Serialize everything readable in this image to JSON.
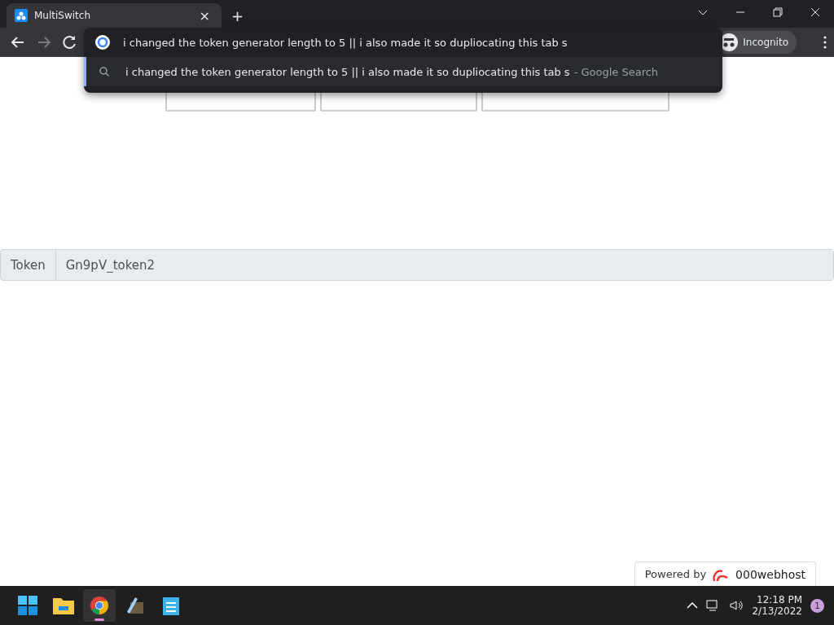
{
  "browser": {
    "tab": {
      "title": "MultiSwitch",
      "close": "×"
    },
    "new_tab": "+",
    "omnibox": {
      "value": "i changed the token generator length to 5 || i also made it so dupliocating this tab s"
    },
    "suggestion": {
      "text": "i changed the token generator length to 5 || i also made it so dupliocating this tab s",
      "source": "- Google Search"
    },
    "profile": "Incognito"
  },
  "page": {
    "buttons": [
      {
        "kind": "button"
      },
      {
        "kind": "button"
      },
      {
        "kind": "button"
      }
    ],
    "token": {
      "label": "Token",
      "value": "Gn9pV_token2"
    },
    "badge": {
      "prefix": "Powered by",
      "brand": "000webhost"
    }
  },
  "taskbar": {
    "apps": [
      {
        "kind": "start",
        "selected": false
      },
      {
        "kind": "files",
        "selected": false
      },
      {
        "kind": "chrome",
        "selected": true
      },
      {
        "kind": "tool",
        "selected": false
      },
      {
        "kind": "notepad",
        "selected": false
      }
    ],
    "time": "12:18 PM",
    "date": "2/13/2022",
    "notifications": "1"
  }
}
